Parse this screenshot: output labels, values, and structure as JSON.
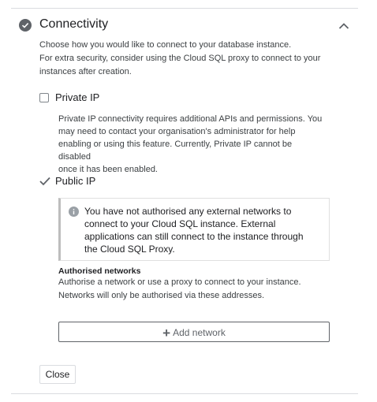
{
  "section": {
    "title": "Connectivity",
    "description_lines": [
      "Choose how you would like to connect to your database instance.",
      "For extra security, consider using the Cloud SQL proxy to connect to your",
      "instances after creation."
    ]
  },
  "private_ip": {
    "label": "Private IP",
    "checked": false,
    "description_lines": [
      "Private IP connectivity requires additional APIs and permissions. You",
      "may need to contact your organisation's administrator for help",
      "enabling or using this feature. Currently, Private IP cannot be disabled",
      "once it has been enabled."
    ]
  },
  "public_ip": {
    "label": "Public IP",
    "checked": true,
    "info_lines": [
      "You have not authorised any external networks to",
      "connect to your Cloud SQL instance. External",
      "applications can still connect to the instance through",
      "the Cloud SQL Proxy."
    ]
  },
  "authorised_networks": {
    "title": "Authorised networks",
    "description_lines": [
      "Authorise a network or use a proxy to connect to your instance.",
      "Networks will only be authorised via these addresses."
    ],
    "add_button_label": "Add network",
    "add_icon": "plus-icon"
  },
  "close_button_label": "Close",
  "icons": {
    "status": "check-circle-icon",
    "collapse": "chevron-up-icon",
    "info": "info-icon",
    "checkbox_checked": "checkmark-icon"
  },
  "colors": {
    "text_primary": "#202124",
    "text_secondary": "#3c4043",
    "icon_grey": "#5f6368",
    "divider": "#dadce0"
  }
}
